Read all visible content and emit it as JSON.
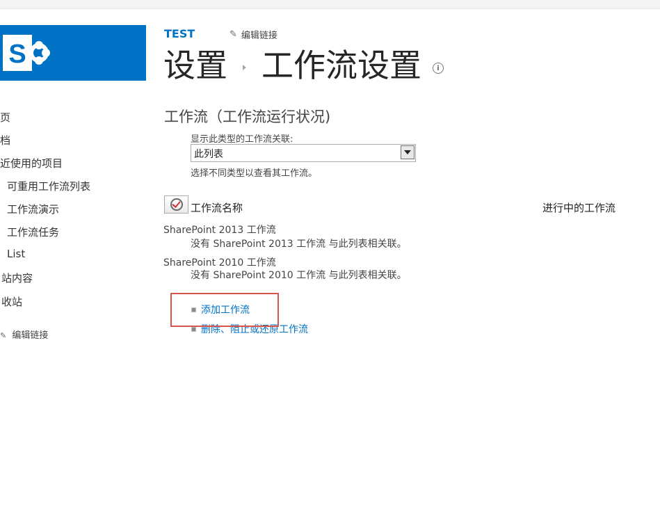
{
  "site": {
    "title": "TEST",
    "edit_links": "编辑链接"
  },
  "breadcrumb": {
    "parent": "设置",
    "current": "工作流设置",
    "info_icon": "info-icon"
  },
  "nav": {
    "items": [
      "页",
      "档",
      "近使用的项目"
    ],
    "sub_items": [
      "可重用工作流列表",
      "工作流演示",
      "工作流任务",
      "List"
    ],
    "bottom_items": [
      "站内容",
      "收站"
    ],
    "edit_links": "编辑链接"
  },
  "main": {
    "section_title": "工作流（工作流运行状况)",
    "filter": {
      "label": "显示此类型的工作流关联:",
      "selected": "此列表",
      "help": "选择不同类型以查看其工作流。"
    },
    "table": {
      "col_name": "工作流名称",
      "col_running": "进行中的工作流"
    },
    "groups": [
      {
        "title": "SharePoint 2013 工作流",
        "message": "没有 SharePoint 2013 工作流 与此列表相关联。"
      },
      {
        "title": "SharePoint 2010 工作流",
        "message": "没有 SharePoint 2010 工作流 与此列表相关联。"
      }
    ],
    "links": [
      "添加工作流",
      "删除、阻止或还原工作流"
    ]
  },
  "colors": {
    "brand": "#0072c6",
    "highlight": "#d9534f"
  }
}
